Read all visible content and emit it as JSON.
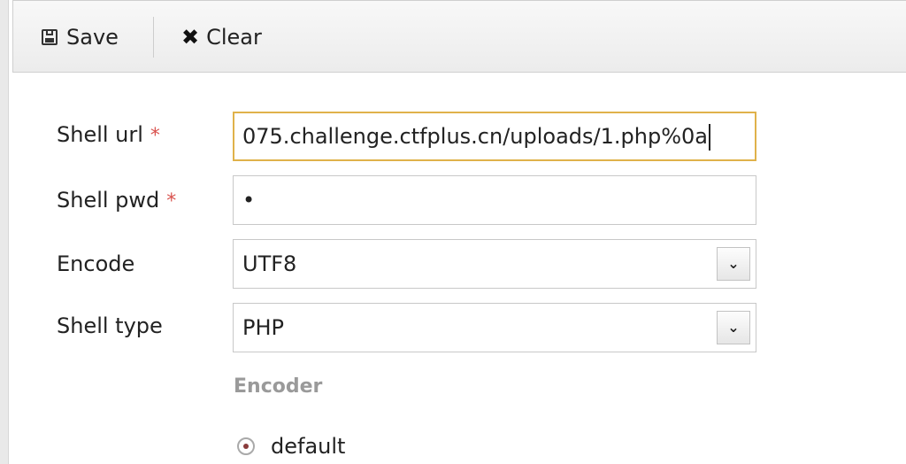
{
  "toolbar": {
    "save_label": "Save",
    "clear_label": "Clear",
    "save_icon": "floppy-disk-icon",
    "clear_icon": "x-icon"
  },
  "form": {
    "shell_url": {
      "label": "Shell url",
      "required_mark": "*",
      "value": "075.challenge.ctfplus.cn/uploads/1.php%0a"
    },
    "shell_pwd": {
      "label": "Shell pwd",
      "required_mark": "*",
      "value": "•"
    },
    "encode": {
      "label": "Encode",
      "value": "UTF8"
    },
    "shell_type": {
      "label": "Shell type",
      "value": "PHP"
    }
  },
  "encoder": {
    "title": "Encoder",
    "options": [
      {
        "label": "default",
        "selected": true
      }
    ]
  },
  "colors": {
    "required": "#d9534f",
    "focus_border": "#e0b24a",
    "section_title": "#9a9a9a"
  }
}
